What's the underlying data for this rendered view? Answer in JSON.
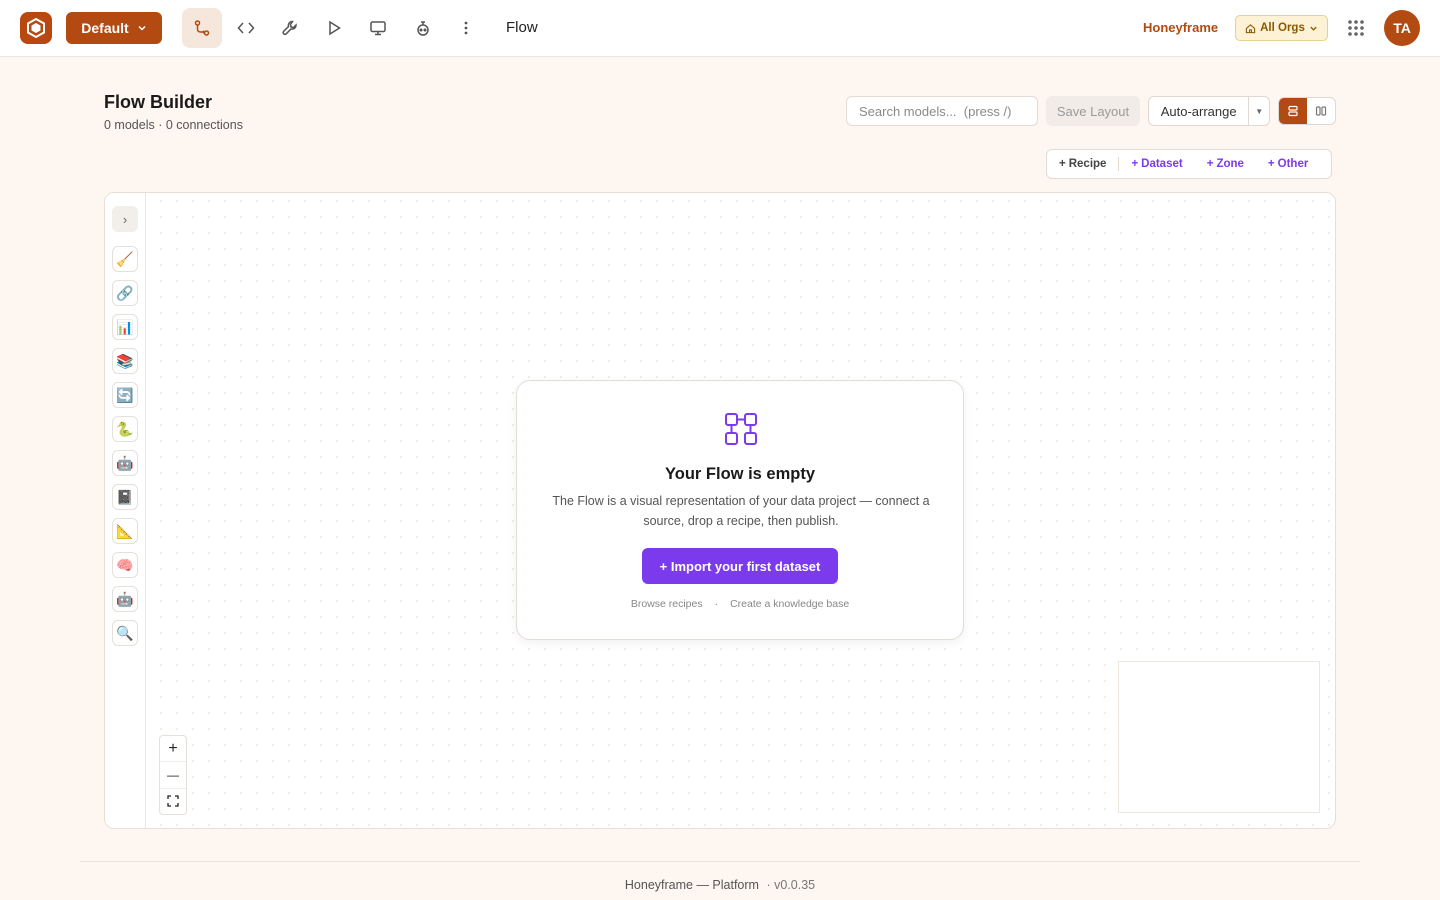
{
  "topbar": {
    "project": "Default",
    "page": "Flow",
    "org_name": "Honeyframe",
    "org_scope": "All Orgs",
    "avatar_initials": "TA",
    "nav_icons": [
      "flow-icon",
      "code-icon",
      "wrench-icon",
      "play-icon",
      "monitor-icon",
      "robot-icon",
      "more-vertical-icon"
    ]
  },
  "header": {
    "title": "Flow Builder",
    "subtitle": "0 models · 0 connections",
    "search_placeholder": "Search models...  (press /)",
    "save_layout": "Save Layout",
    "auto_arrange": "Auto-arrange"
  },
  "add_bar": {
    "items": [
      "Recipe",
      "Dataset",
      "Zone",
      "Other"
    ]
  },
  "tools": [
    "🧹",
    "🔗",
    "📊",
    "📚",
    "🔄",
    "🐍",
    "🤖",
    "📓",
    "📐",
    "🧠",
    "🤖",
    "🔍"
  ],
  "empty_state": {
    "title": "Your Flow is empty",
    "description": "The Flow is a visual representation of your data project — connect a source, drop a recipe, then publish.",
    "cta": "+ Import your first dataset",
    "link_recipes": "Browse recipes",
    "link_separator": "·",
    "link_kb": "Create a knowledge base"
  },
  "zoom": {
    "in": "+",
    "out": "—"
  },
  "footer": {
    "text": "Honeyframe — Platform",
    "version": "· v0.0.35"
  },
  "colors": {
    "brand": "#b34a12",
    "accent": "#7c3aed",
    "background": "#fdf6f1"
  }
}
